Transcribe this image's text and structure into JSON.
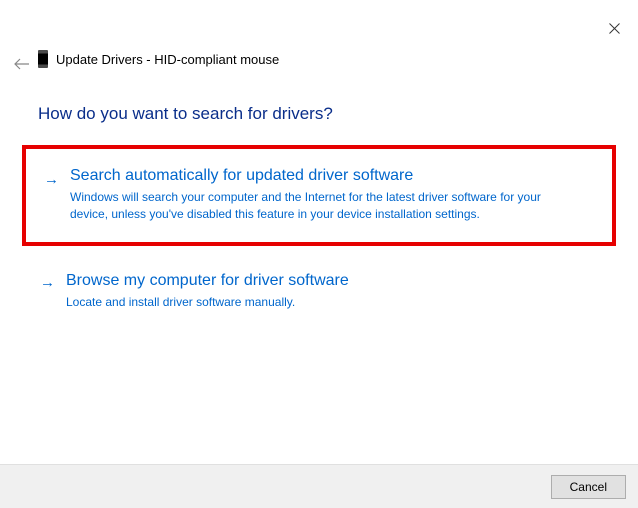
{
  "window": {
    "title": "Update Drivers - HID-compliant mouse"
  },
  "heading": "How do you want to search for drivers?",
  "options": [
    {
      "title": "Search automatically for updated driver software",
      "description": "Windows will search your computer and the Internet for the latest driver software for your device, unless you've disabled this feature in your device installation settings."
    },
    {
      "title": "Browse my computer for driver software",
      "description": "Locate and install driver software manually."
    }
  ],
  "buttons": {
    "cancel": "Cancel"
  }
}
